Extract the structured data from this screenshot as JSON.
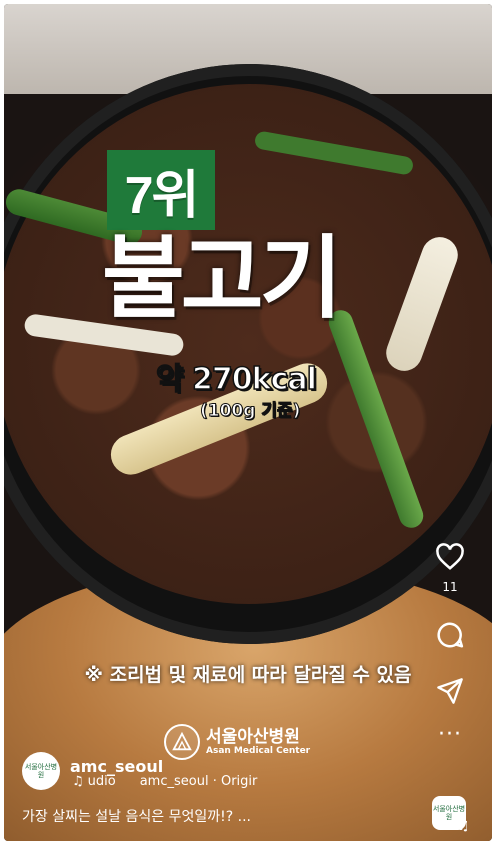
{
  "overlay": {
    "rank": "7위",
    "dish_name": "불고기",
    "calories": "약 270kcal",
    "portion": "(100g 기준)",
    "disclaimer": "※ 조리법 및 재료에 따라 달라질 수 있음",
    "brand_ko": "서울아산병원",
    "brand_en": "Asan Medical Center"
  },
  "actions": {
    "like_count": "11",
    "more": "···"
  },
  "post": {
    "username": "amc_seoul",
    "audio_label": "udio",
    "audio_source": "amc_seoul · Origir",
    "caption": "가장 살찌는 설날 음식은 무엇일까!? ...",
    "avatar_text": "서울아산병원",
    "thumb_text": "서울아산병원"
  },
  "icons": [
    "heart-icon",
    "comment-icon",
    "share-icon",
    "more-icon",
    "music-icon"
  ],
  "colors": {
    "rank_bg": "#1f7a3a",
    "text": "#ffffff"
  }
}
